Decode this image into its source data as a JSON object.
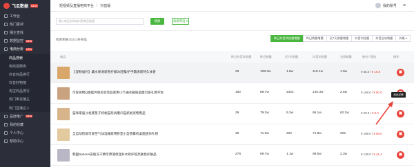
{
  "brand": {
    "name": "飞瓜数据",
    "tag": "NEW"
  },
  "sidebar": {
    "items": [
      {
        "label": "工作台",
        "type": "item"
      },
      {
        "label": "热门素材",
        "type": "item"
      },
      {
        "label": "播主查找",
        "type": "item"
      },
      {
        "label": "数据监控",
        "type": "item",
        "badge": "NEW"
      },
      {
        "label": "电商分析",
        "type": "open",
        "badge": "NEW"
      },
      {
        "label": "商品搜索",
        "type": "sub-active"
      },
      {
        "label": "电商视频库",
        "type": "sub"
      },
      {
        "label": "抖音商品排行",
        "type": "sub"
      },
      {
        "label": "抖音好物榜",
        "type": "sub"
      },
      {
        "label": "淘宝商品排行",
        "type": "sub"
      },
      {
        "label": "热门带货播主",
        "type": "sub"
      },
      {
        "label": "热门直播达人",
        "type": "sub"
      },
      {
        "label": "品牌推广",
        "type": "item",
        "badge": "NEW"
      },
      {
        "label": "我的收藏",
        "type": "item"
      },
      {
        "label": "个人中心",
        "type": "item"
      },
      {
        "label": "帮助中心",
        "type": "item"
      }
    ]
  },
  "topbar": {
    "crumb1": "短视频及直播电商平台",
    "crumb2": "抖音版",
    "user": "我的账号"
  },
  "search": {
    "placeholder": "输入商品名称或抖音商品链接",
    "button": "搜索",
    "filter": "高级筛选 ▾"
  },
  "table": {
    "meta": "找到相关20321条商品",
    "sorts": [
      {
        "label": "昨日抖音浏览量增量",
        "active": true
      },
      {
        "label": "昨日销量增量",
        "active": false
      },
      {
        "label": "近7天销量增量",
        "active": false
      },
      {
        "label": "抖音浏览量",
        "active": false
      },
      {
        "label": "抖音全站销量",
        "active": false
      },
      {
        "label": "价格 ▾",
        "active": false
      }
    ],
    "headers": [
      "商品",
      "昨日抖音浏览量",
      "昨日销量",
      "近7天销量",
      "抖音浏览量",
      "全网销量",
      "售价 / 佣金",
      "操作"
    ],
    "tooltip": "商品详情",
    "rows": [
      {
        "title": "【宠粉福利】藏水果清新香柠檬沐浴露/护手霜清新持久体香",
        "views": "29",
        "sales_yday": "108.3w",
        "sales_7d": "1.8w",
        "total_views": "115.1w",
        "total_sales": "1.9w",
        "price": "¥ 66.0 /",
        "commission": "¥ 19.8"
      },
      {
        "title": "可爱食物Q版摆件厨房装饰品家用小卡通冰箱贴桌面可爱礼物学生",
        "views": "192",
        "sales_yday": "88.7w",
        "sales_7d": "2424",
        "total_views": "140.3w",
        "total_sales": "2.5w",
        "price": "¥ 168.0 /",
        "commission": "¥ 90.0"
      },
      {
        "title": "猫咪家居沙发底垫子抓板猫玩具磨爪猫抓板宠物用品",
        "views": "29",
        "sales_yday": "79.2w",
        "sales_7d": "5.2w",
        "total_views": "86.1w",
        "total_sales": "62.2w",
        "price": "¥ 20.0 /",
        "commission": "¥ 8.0"
      },
      {
        "title": "全自动智能可爱空气加湿器家用卧室小型香薰机桌面迷你礼物",
        "views": "30",
        "sales_yday": "71.6w",
        "sales_7d": "202",
        "total_views": "74.8w",
        "total_sales": "202",
        "price": "¥ 198.0 /",
        "commission": "¥ 59.0"
      },
      {
        "title": "韩国Sphere/安瓶冻干精华原液保湿补水修护提亮肤色护肤品",
        "views": "276",
        "sales_yday": "69.7w",
        "sales_7d": "1.1w",
        "total_views": "88.5w",
        "total_sales": "2.3w",
        "price": "¥ 138.0 /",
        "commission": "¥ 41.4"
      }
    ]
  }
}
